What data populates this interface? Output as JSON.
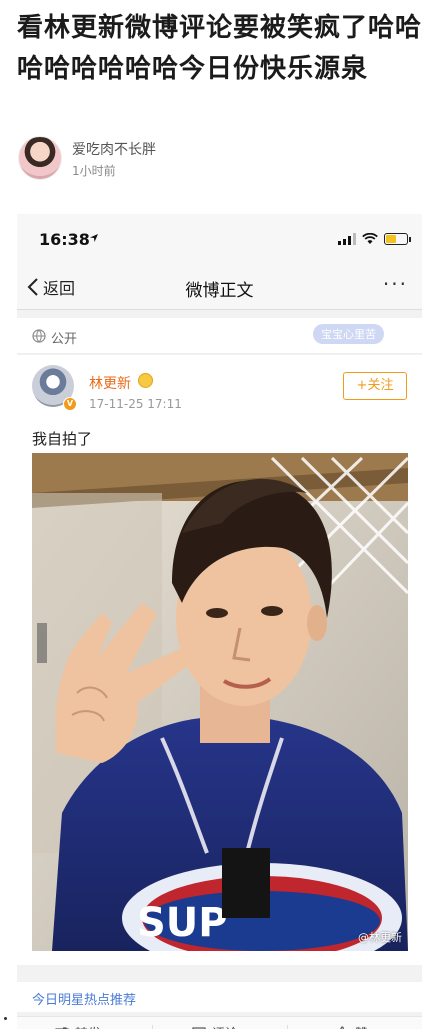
{
  "article": {
    "title": "看林更新微博评论要被笑疯了哈哈哈哈哈哈哈哈今日份快乐源泉",
    "author": "爱吃肉不长胖",
    "time": "1小时前"
  },
  "phone": {
    "status": {
      "time": "16:38"
    },
    "nav": {
      "back": "返回",
      "title": "微博正文",
      "more": "···"
    },
    "visibility": "公开",
    "watermark": "宝宝心里苦",
    "post": {
      "user": "林更新",
      "time": "17-11-25 17:11",
      "follow": "+关注",
      "text": "我自拍了",
      "photo_watermark": "@林更新"
    },
    "hot": "今日明星热点推荐",
    "actions": {
      "repost": "转发",
      "comment": "评论",
      "like": "赞"
    }
  },
  "colors": {
    "accent_orange": "#f29b1a",
    "link_blue": "#4a7bd6",
    "username_orange": "#e86d1a"
  },
  "icons": [
    "location-arrow-icon",
    "signal-icon",
    "wifi-icon",
    "battery-icon",
    "back-chevron-icon",
    "more-icon",
    "globe-icon",
    "verified-icon",
    "vip-icon",
    "repost-icon",
    "comment-icon",
    "like-icon"
  ]
}
